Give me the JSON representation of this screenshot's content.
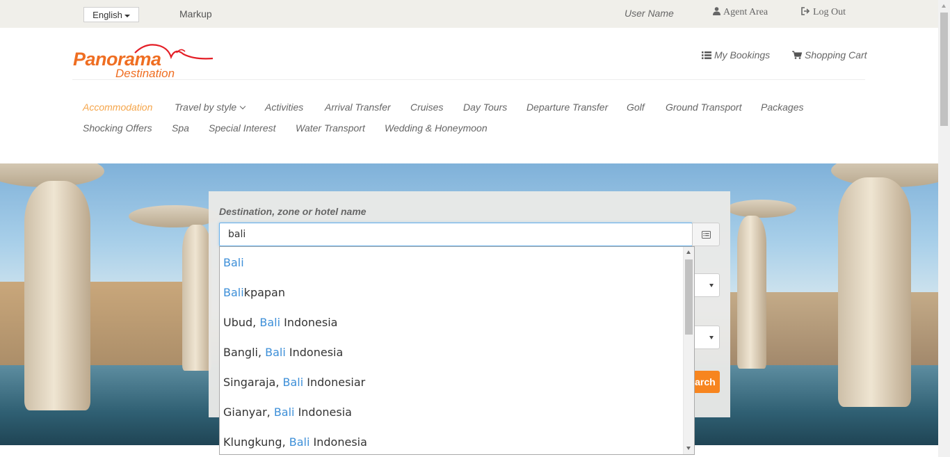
{
  "topbar": {
    "language": "English",
    "markup": "Markup",
    "user_name": "User Name",
    "agent_area": "Agent Area",
    "log_out": "Log Out"
  },
  "logo": {
    "word": "Panorama",
    "sub": "Destination"
  },
  "header": {
    "my_bookings": "My Bookings",
    "shopping_cart": "Shopping Cart"
  },
  "nav": [
    {
      "label": "Accommodation",
      "active": true
    },
    {
      "label": "Travel by style",
      "dropdown": true
    },
    {
      "label": "Activities"
    },
    {
      "label": "Arrival Transfer"
    },
    {
      "label": "Cruises"
    },
    {
      "label": "Day Tours"
    },
    {
      "label": "Departure Transfer"
    },
    {
      "label": "Golf"
    },
    {
      "label": "Ground Transport"
    },
    {
      "label": "Packages"
    },
    {
      "label": "Shocking Offers"
    },
    {
      "label": "Spa"
    },
    {
      "label": "Special Interest"
    },
    {
      "label": "Water Transport"
    },
    {
      "label": "Wedding & Honeymoon"
    }
  ],
  "search": {
    "destination_label": "Destination, zone or hotel name",
    "destination_value": "bali",
    "search_button": "Search"
  },
  "autocomplete": [
    {
      "pre": "",
      "match": "Bali",
      "post": ""
    },
    {
      "pre": "",
      "match": "Bali",
      "post": "kpapan"
    },
    {
      "pre": "Ubud, ",
      "match": "Bali",
      "post": " Indonesia"
    },
    {
      "pre": "Bangli, ",
      "match": "Bali",
      "post": " Indonesia"
    },
    {
      "pre": "Singaraja, ",
      "match": "Bali",
      "post": " Indonesiar"
    },
    {
      "pre": "Gianyar, ",
      "match": "Bali",
      "post": " Indonesia"
    },
    {
      "pre": "Klungkung, ",
      "match": "Bali",
      "post": " Indonesia"
    }
  ],
  "colors": {
    "brand_orange": "#ef6e22",
    "nav_active": "#f5a54a",
    "search_button": "#f7851f",
    "match_highlight": "#3d8fd8"
  },
  "icons": [
    "caret-down-icon",
    "user-icon",
    "sign-out-icon",
    "list-icon",
    "cart-icon",
    "chevron-down-icon",
    "list-alt-icon",
    "select-arrow-icon"
  ]
}
